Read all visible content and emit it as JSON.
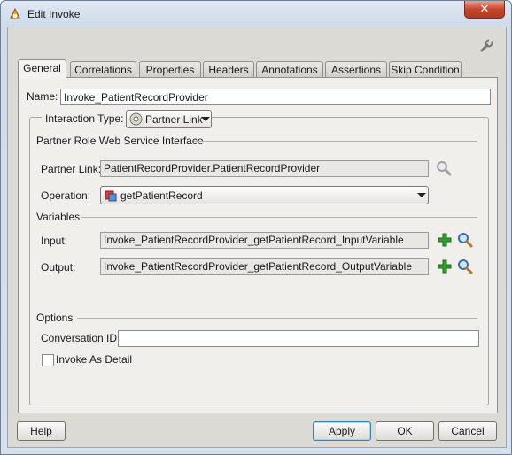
{
  "window": {
    "title": "Edit Invoke",
    "close_glyph": "✕"
  },
  "tabs": [
    {
      "label": "General",
      "active": true
    },
    {
      "label": "Correlations"
    },
    {
      "label": "Properties"
    },
    {
      "label": "Headers"
    },
    {
      "label": "Annotations"
    },
    {
      "label": "Assertions"
    },
    {
      "label": "Skip Condition"
    }
  ],
  "general": {
    "name_label": "Name:",
    "name_value": "Invoke_PatientRecordProvider",
    "interaction_type_label": "Interaction Type:",
    "interaction_type_value": "Partner Link",
    "partner_section_title": "Partner Role Web Service Interface",
    "partner_link_label": "Partner Link:",
    "partner_link_value": "PatientRecordProvider.PatientRecordProvider",
    "operation_label": "Operation:",
    "operation_value": "getPatientRecord",
    "variables_title": "Variables",
    "input_label": "Input:",
    "input_value": "Invoke_PatientRecordProvider_getPatientRecord_InputVariable",
    "output_label": "Output:",
    "output_value": "Invoke_PatientRecordProvider_getPatientRecord_OutputVariable",
    "options_title": "Options",
    "conversation_id_label": "Conversation ID:",
    "conversation_id_value": "",
    "invoke_as_detail_label": "Invoke As Detail",
    "invoke_as_detail_checked": false
  },
  "buttons": {
    "help": "Help",
    "apply": "Apply",
    "ok": "OK",
    "cancel": "Cancel"
  },
  "icons": {
    "title": "invoke-app-icon",
    "settings": "wrench-icon",
    "browse": "magnifier-icon",
    "add": "green-plus-icon",
    "operation": "operation-icon",
    "partner_link": "partner-link-icon"
  },
  "colors": {
    "close_button": "#c7462c",
    "accent": "#3c7fb1",
    "add_icon": "#2e9e2e"
  }
}
